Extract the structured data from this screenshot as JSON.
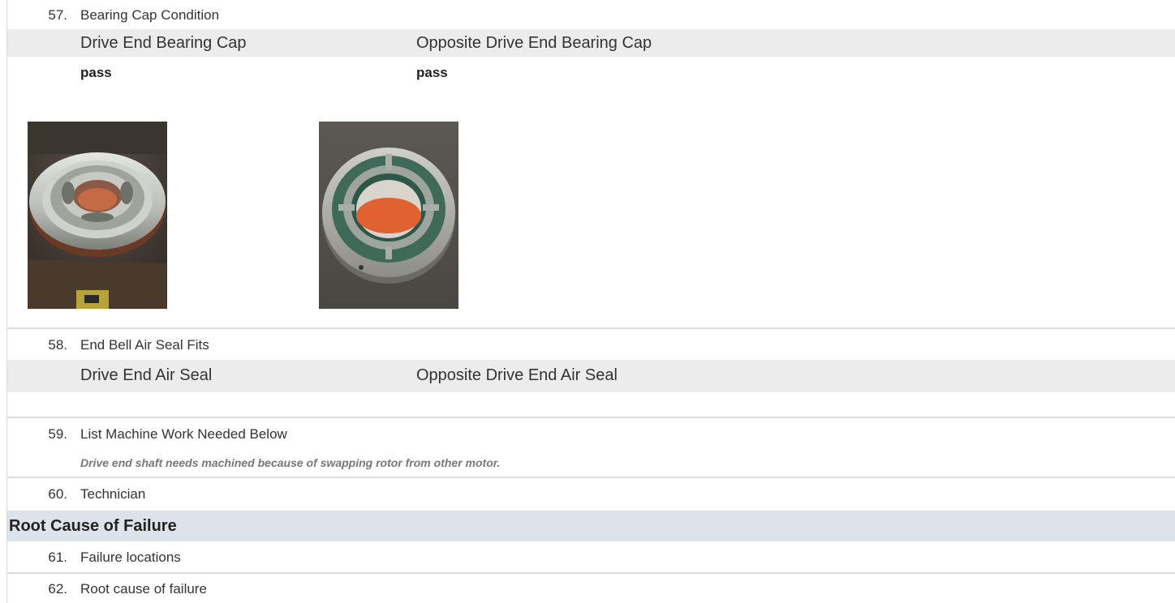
{
  "items": {
    "q57": {
      "num": "57.",
      "label": "Bearing Cap Condition"
    },
    "q58": {
      "num": "58.",
      "label": "End Bell Air Seal Fits"
    },
    "q59": {
      "num": "59.",
      "label": "List Machine Work Needed Below"
    },
    "q60": {
      "num": "60.",
      "label": "Technician"
    },
    "q61": {
      "num": "61.",
      "label": "Failure locations"
    },
    "q62": {
      "num": "62.",
      "label": "Root cause of failure"
    }
  },
  "bearing_cap": {
    "col1_header": "Drive End Bearing Cap",
    "col2_header": "Opposite Drive End Bearing Cap",
    "col1_value": "pass",
    "col2_value": "pass"
  },
  "air_seal": {
    "col1_header": "Drive End Air Seal",
    "col2_header": "Opposite Drive End Air Seal"
  },
  "machine_work_note": "Drive end shaft needs machined because of swapping rotor from other motor.",
  "section_root_cause": "Root Cause of Failure"
}
